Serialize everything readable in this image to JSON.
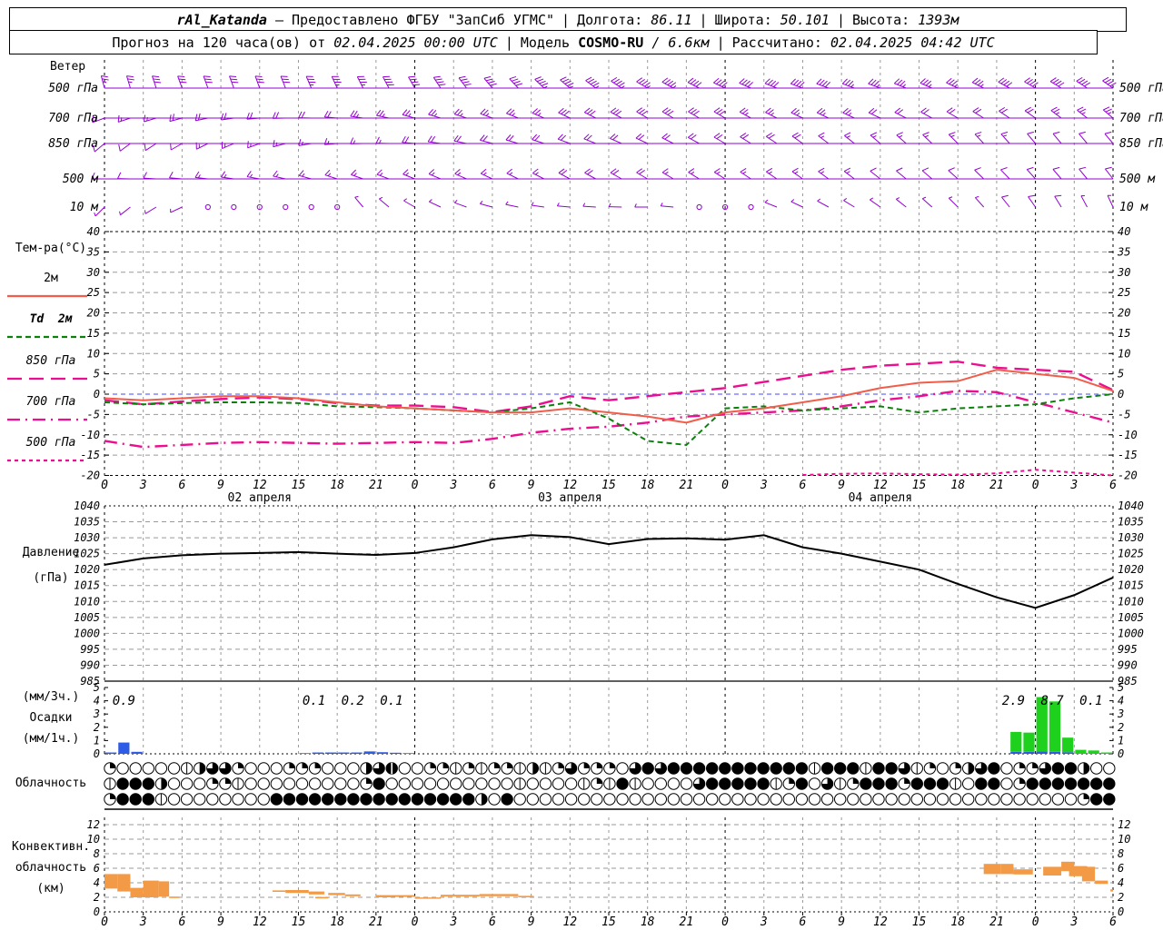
{
  "header": {
    "sep": "|",
    "station": "rAl_Katanda",
    "provided": "— Предоставлено ФГБУ \"ЗапСиб УГМС\"",
    "lon_label": "Долгота:",
    "lon": "86.11",
    "lat_label": "Широта:",
    "lat": "50.101",
    "alt_label": "Высота:",
    "alt": "1393м",
    "forecast_label": "Прогноз на 120 часа(ов) от",
    "forecast_start": "02.04.2025 00:00 UTC",
    "model_label": "Модель",
    "model_name": "COSMO-RU",
    "model_res": "/ 6.6км",
    "calc_label": "Рассчитано:",
    "calc_time": "02.04.2025 04:42 UTC"
  },
  "labels": {
    "wind_title": "Ветер",
    "temp_title": "Тем-ра(°C)",
    "pressure_1": "Давление",
    "pressure_2": "(гПа)",
    "precip_1": "(мм/3ч.)",
    "precip_2": "Осадки",
    "precip_3": "(мм/1ч.)",
    "cloud_title": "Облачность",
    "conv_1": "Конвективн.",
    "conv_2": "облачность",
    "conv_3": "(км)"
  },
  "chart_data": {
    "type": "meteogram",
    "x_hours_range": [
      0,
      78
    ],
    "hour_tick_step": 3,
    "hour_tick_labels": [
      "0",
      "3",
      "6",
      "9",
      "12",
      "15",
      "18",
      "21",
      "0",
      "3",
      "6",
      "9",
      "12",
      "15",
      "18",
      "21",
      "0",
      "3",
      "6",
      "9",
      "12",
      "15",
      "18",
      "21",
      "0",
      "3",
      "6"
    ],
    "dates": [
      {
        "label": "02 апреля",
        "h": 12
      },
      {
        "label": "03 апреля",
        "h": 36
      },
      {
        "label": "04 апреля",
        "h": 60
      }
    ],
    "wind": {
      "color": "#9400d3",
      "levels": [
        {
          "num": "500",
          "unit": "гПа",
          "y": 97,
          "line": true,
          "dir": [
            345,
            340,
            340,
            335,
            330,
            320,
            310,
            300,
            295,
            290,
            290,
            295,
            300,
            305
          ],
          "kt": [
            25,
            30,
            30,
            35,
            40,
            40,
            45,
            45,
            40,
            40,
            35,
            35,
            40,
            40
          ]
        },
        {
          "num": "700",
          "unit": "гПа",
          "y": 130,
          "line": true,
          "dir": [
            250,
            255,
            265,
            275,
            285,
            290,
            295,
            300,
            300,
            295,
            295,
            300,
            305,
            310
          ],
          "kt": [
            15,
            18,
            20,
            22,
            25,
            25,
            28,
            30,
            28,
            25,
            22,
            20,
            22,
            25
          ]
        },
        {
          "num": "850",
          "unit": "гПа",
          "y": 158,
          "line": true,
          "dir": [
            230,
            240,
            250,
            265,
            275,
            285,
            290,
            295,
            300,
            305,
            310,
            315,
            320,
            320
          ],
          "kt": [
            10,
            12,
            15,
            15,
            18,
            20,
            20,
            22,
            20,
            18,
            15,
            15,
            12,
            10
          ]
        },
        {
          "num": "500",
          "unit": "м",
          "y": 197,
          "line": true,
          "dir": [
            270,
            275,
            280,
            288,
            292,
            295,
            298,
            300,
            302,
            305,
            308,
            312,
            318,
            322
          ],
          "kt": [
            10,
            12,
            14,
            15,
            15,
            16,
            18,
            18,
            15,
            14,
            12,
            10,
            10,
            12
          ]
        },
        {
          "num": "10",
          "unit": "м",
          "y": 228,
          "line": false,
          "dir": [
            225,
            245,
            310,
            330,
            300,
            285,
            275,
            270,
            285,
            295,
            305,
            315,
            325,
            335
          ],
          "kt": [
            5,
            3,
            0,
            2,
            4,
            5,
            6,
            5,
            0,
            5,
            6,
            7,
            8,
            7
          ]
        }
      ]
    },
    "temperature": {
      "ticks": [
        40,
        35,
        30,
        25,
        20,
        15,
        10,
        5,
        0,
        -5,
        -10,
        -15,
        -20
      ],
      "ylim": [
        -20,
        40
      ],
      "zero_line_color": "#4444ff",
      "step_hours": 3,
      "legend": [
        {
          "label": "2м",
          "color": "#f25c4a",
          "dash": ""
        },
        {
          "label": "Td  2м",
          "color": "#0b800b",
          "dash": "6 4"
        },
        {
          "label": "850 гПа",
          "color": "#ec0e8e",
          "dash": "16 8"
        },
        {
          "label": "700 гПа",
          "color": "#ec0e8e",
          "dash": "14 6 2 6"
        },
        {
          "label": "500 гПа",
          "color": "#ec0e8e",
          "dash": "4 4"
        }
      ],
      "series": {
        "t2m": [
          -1,
          -1.5,
          -1,
          -0.5,
          -0.5,
          -1,
          -2,
          -3,
          -3.5,
          -4,
          -4.5,
          -4.5,
          -3.5,
          -4.5,
          -5.5,
          -7,
          -4.5,
          -3.5,
          -2,
          -0.5,
          1.5,
          2.8,
          3.2,
          6,
          5,
          4,
          0.8
        ],
        "td2m": [
          -2,
          -2.5,
          -2.2,
          -2,
          -2,
          -2.2,
          -3,
          -3.2,
          -3.5,
          -4,
          -4.5,
          -3.5,
          -2,
          -6,
          -11.5,
          -12.5,
          -3.5,
          -3,
          -4,
          -3.5,
          -3,
          -4.5,
          -3.5,
          -3,
          -2.5,
          -1,
          0
        ],
        "t850": [
          -1.5,
          -2.5,
          -1.8,
          -1.2,
          -0.8,
          -1.2,
          -2.2,
          -2.8,
          -2.8,
          -3.2,
          -4.4,
          -3,
          -0.5,
          -1.5,
          -0.5,
          0.5,
          1.5,
          3,
          4.5,
          6,
          7,
          7.5,
          8,
          6.5,
          6,
          5.5,
          1
        ],
        "t700": [
          -11.5,
          -13,
          -12.5,
          -12,
          -11.8,
          -12,
          -12.2,
          -12,
          -11.8,
          -12,
          -11,
          -9.5,
          -8.5,
          -8,
          -7,
          -5.5,
          -5,
          -4.5,
          -4,
          -3,
          -1.5,
          -0.5,
          0.8,
          0.5,
          -2,
          -4.5,
          -7
        ],
        "t500": [
          null,
          null,
          null,
          null,
          null,
          null,
          null,
          null,
          null,
          null,
          null,
          null,
          null,
          null,
          null,
          null,
          null,
          null,
          -19.9,
          -19.6,
          -19.5,
          -19.7,
          -19.8,
          -19.5,
          -18.6,
          -19.3,
          -20
        ]
      }
    },
    "pressure": {
      "ticks": [
        1040,
        1035,
        1030,
        1025,
        1020,
        1015,
        1010,
        1005,
        1000,
        995,
        990,
        985
      ],
      "ylim": [
        985,
        1040
      ],
      "color": "#000000",
      "step_hours": 3,
      "series": [
        1021.5,
        1023.5,
        1024.5,
        1025,
        1025.2,
        1025.5,
        1025,
        1024.6,
        1025.2,
        1027,
        1029.5,
        1030.8,
        1030.2,
        1028,
        1029.6,
        1029.8,
        1029.4,
        1030.8,
        1027,
        1025,
        1022.5,
        1020,
        1015.5,
        1011.3,
        1008,
        1012,
        1017.5
      ]
    },
    "precip": {
      "ticks": [
        5,
        4,
        3,
        2,
        1,
        0
      ],
      "ylim": [
        0,
        5
      ],
      "rain_color": "#2f5ce6",
      "snow_color": "#1dd11d",
      "bars": [
        [
          0,
          0.1,
          0
        ],
        [
          1,
          0.85,
          0
        ],
        [
          2,
          0.15,
          0
        ],
        [
          15,
          0.05,
          0
        ],
        [
          16,
          0.1,
          0
        ],
        [
          17,
          0.1,
          0
        ],
        [
          18,
          0.1,
          0
        ],
        [
          19,
          0.1,
          0
        ],
        [
          20,
          0.18,
          0
        ],
        [
          21,
          0.12,
          0
        ],
        [
          22,
          0.08,
          0
        ],
        [
          23,
          0.05,
          0
        ],
        [
          70,
          0.15,
          1.5
        ],
        [
          71,
          0.15,
          1.45
        ],
        [
          72,
          0.18,
          4.1
        ],
        [
          73,
          0.15,
          3.8
        ],
        [
          74,
          0.12,
          1.1
        ],
        [
          75,
          0,
          0.3
        ],
        [
          76,
          0,
          0.25
        ],
        [
          77,
          0,
          0.1
        ]
      ],
      "labels": [
        {
          "h": 1.5,
          "text": "0.9"
        },
        {
          "h": 16.2,
          "text": "0.1"
        },
        {
          "h": 19.2,
          "text": "0.2"
        },
        {
          "h": 22.2,
          "text": "0.1"
        },
        {
          "h": 70.3,
          "text": "2.9"
        },
        {
          "h": 73.3,
          "text": "8.7"
        },
        {
          "h": 76.3,
          "text": "0.1"
        }
      ]
    },
    "cloud": {
      "rows": [
        "2000001466200022200046700221212214126222068688888888888188818861202468022688400",
        "1888400022100000000028000000000010000121810000688888128061288828881088028888888",
        "2888100000000888888888888888840800000000000000000000000000000000000000000000288"
      ]
    },
    "convective": {
      "ticks": [
        12,
        10,
        8,
        6,
        4,
        2,
        0
      ],
      "ylim": [
        0,
        13
      ],
      "color": "#f29a45",
      "bars": [
        [
          0,
          1,
          3.2,
          5.2
        ],
        [
          1,
          2,
          2.8,
          5.2
        ],
        [
          2,
          3,
          2.0,
          3.3
        ],
        [
          3,
          4.2,
          2.0,
          4.3
        ],
        [
          4.2,
          5,
          2.1,
          4.2
        ],
        [
          5,
          5.8,
          1.9,
          2.1
        ],
        [
          13,
          14,
          2.75,
          2.95
        ],
        [
          14,
          15.8,
          2.6,
          3.0
        ],
        [
          15.8,
          17,
          2.4,
          2.8
        ],
        [
          16.3,
          17.3,
          1.85,
          2.05
        ],
        [
          17.3,
          18.6,
          2.3,
          2.6
        ],
        [
          18.6,
          19.8,
          2.15,
          2.4
        ],
        [
          21,
          22.2,
          2.0,
          2.3
        ],
        [
          22.2,
          24,
          2.05,
          2.3
        ],
        [
          24,
          26,
          1.8,
          1.98
        ],
        [
          26,
          29,
          2.1,
          2.35
        ],
        [
          29,
          32,
          2.15,
          2.45
        ],
        [
          32,
          33.2,
          2.0,
          2.2
        ],
        [
          68,
          69.3,
          5.2,
          6.6
        ],
        [
          69.3,
          70.3,
          5.2,
          6.6
        ],
        [
          70.3,
          71.8,
          5.15,
          5.85
        ],
        [
          72.6,
          74,
          5.0,
          6.2
        ],
        [
          74,
          75,
          5.6,
          6.9
        ],
        [
          74.6,
          76,
          4.9,
          6.3
        ],
        [
          75.6,
          76.6,
          4.2,
          6.2
        ],
        [
          76.6,
          77.6,
          3.85,
          4.3
        ],
        [
          77.8,
          78,
          2.8,
          3.1
        ]
      ]
    }
  }
}
